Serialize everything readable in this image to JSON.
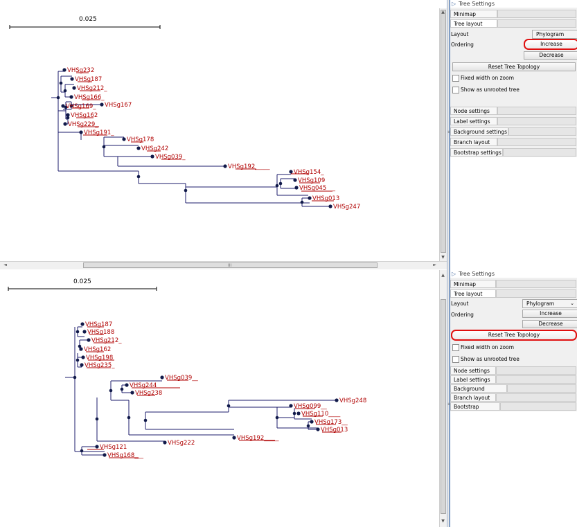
{
  "colors": {
    "branch": "#1b1b6b",
    "node": "#111a4a",
    "leaf_label": "#b00000",
    "highlight": "#e01010"
  },
  "top_view": {
    "scale_bar_label": "0.025",
    "leaves": [
      {
        "label": "VHSg232"
      },
      {
        "label": "VHSg187"
      },
      {
        "label": "VHSg212_"
      },
      {
        "label": "VHSg166_"
      },
      {
        "label": "VHSg167"
      },
      {
        "label": "VHSg169_"
      },
      {
        "label": "VHSg162"
      },
      {
        "label": "VHSg229_"
      },
      {
        "label": "VHSg191_"
      },
      {
        "label": "VHSg178"
      },
      {
        "label": "VHSg242"
      },
      {
        "label": "VHSg039_"
      },
      {
        "label": "VHSg192_____"
      },
      {
        "label": "VHSg154_"
      },
      {
        "label": "VHSg109"
      },
      {
        "label": "VHSg045___"
      },
      {
        "label": "VHSg013"
      },
      {
        "label": "VHSg247"
      }
    ],
    "scrollbar_grip": "III",
    "settings": {
      "header": "Tree Settings",
      "minimap_tab": "Minimap",
      "tree_layout_tab": "Tree layout",
      "layout_label": "Layout",
      "layout_value": "Phylogram",
      "ordering_label": "Ordering",
      "increase_button": "Increase",
      "decrease_button": "Decrease",
      "reset_button": "Reset Tree Topology",
      "fixed_width_label": "Fixed width on zoom",
      "unrooted_label": "Show as unrooted tree",
      "node_settings": "Node settings",
      "label_settings": "Label settings",
      "background_settings": "Background settings",
      "branch_layout": "Branch layout",
      "bootstrap_settings": "Bootstrap settings"
    }
  },
  "bottom_view": {
    "scale_bar_label": "0.025",
    "leaves": [
      {
        "label": "VHSg187"
      },
      {
        "label": "VHSg188"
      },
      {
        "label": "VHSg212_"
      },
      {
        "label": "VHSg162"
      },
      {
        "label": "VHSg198"
      },
      {
        "label": "VHSg235_"
      },
      {
        "label": "VHSg039__"
      },
      {
        "label": "VHSg244"
      },
      {
        "label": "VHSg238"
      },
      {
        "label": "VHSg248"
      },
      {
        "label": "VHSg099__"
      },
      {
        "label": "VHSg110____"
      },
      {
        "label": "VHSg173__"
      },
      {
        "label": "VHSg013"
      },
      {
        "label": "VHSg222"
      },
      {
        "label": "VHSg192_____"
      },
      {
        "label": "VHSg121"
      },
      {
        "label": "VHSg168___"
      }
    ],
    "settings": {
      "header": "Tree Settings",
      "minimap_tab": "Minimap",
      "tree_layout_tab": "Tree layout",
      "layout_label": "Layout",
      "layout_value": "Phylogram",
      "ordering_label": "Ordering",
      "increase_button": "Increase",
      "decrease_button": "Decrease",
      "reset_button": "Reset Tree Topology",
      "fixed_width_label": "Fixed width on zoom",
      "unrooted_label": "Show as unrooted tree",
      "node_settings": "Node settings",
      "label_settings": "Label settings",
      "background_settings": "Background settings",
      "branch_layout": "Branch layout",
      "bootstrap_settings": "Bootstrap settings"
    }
  }
}
